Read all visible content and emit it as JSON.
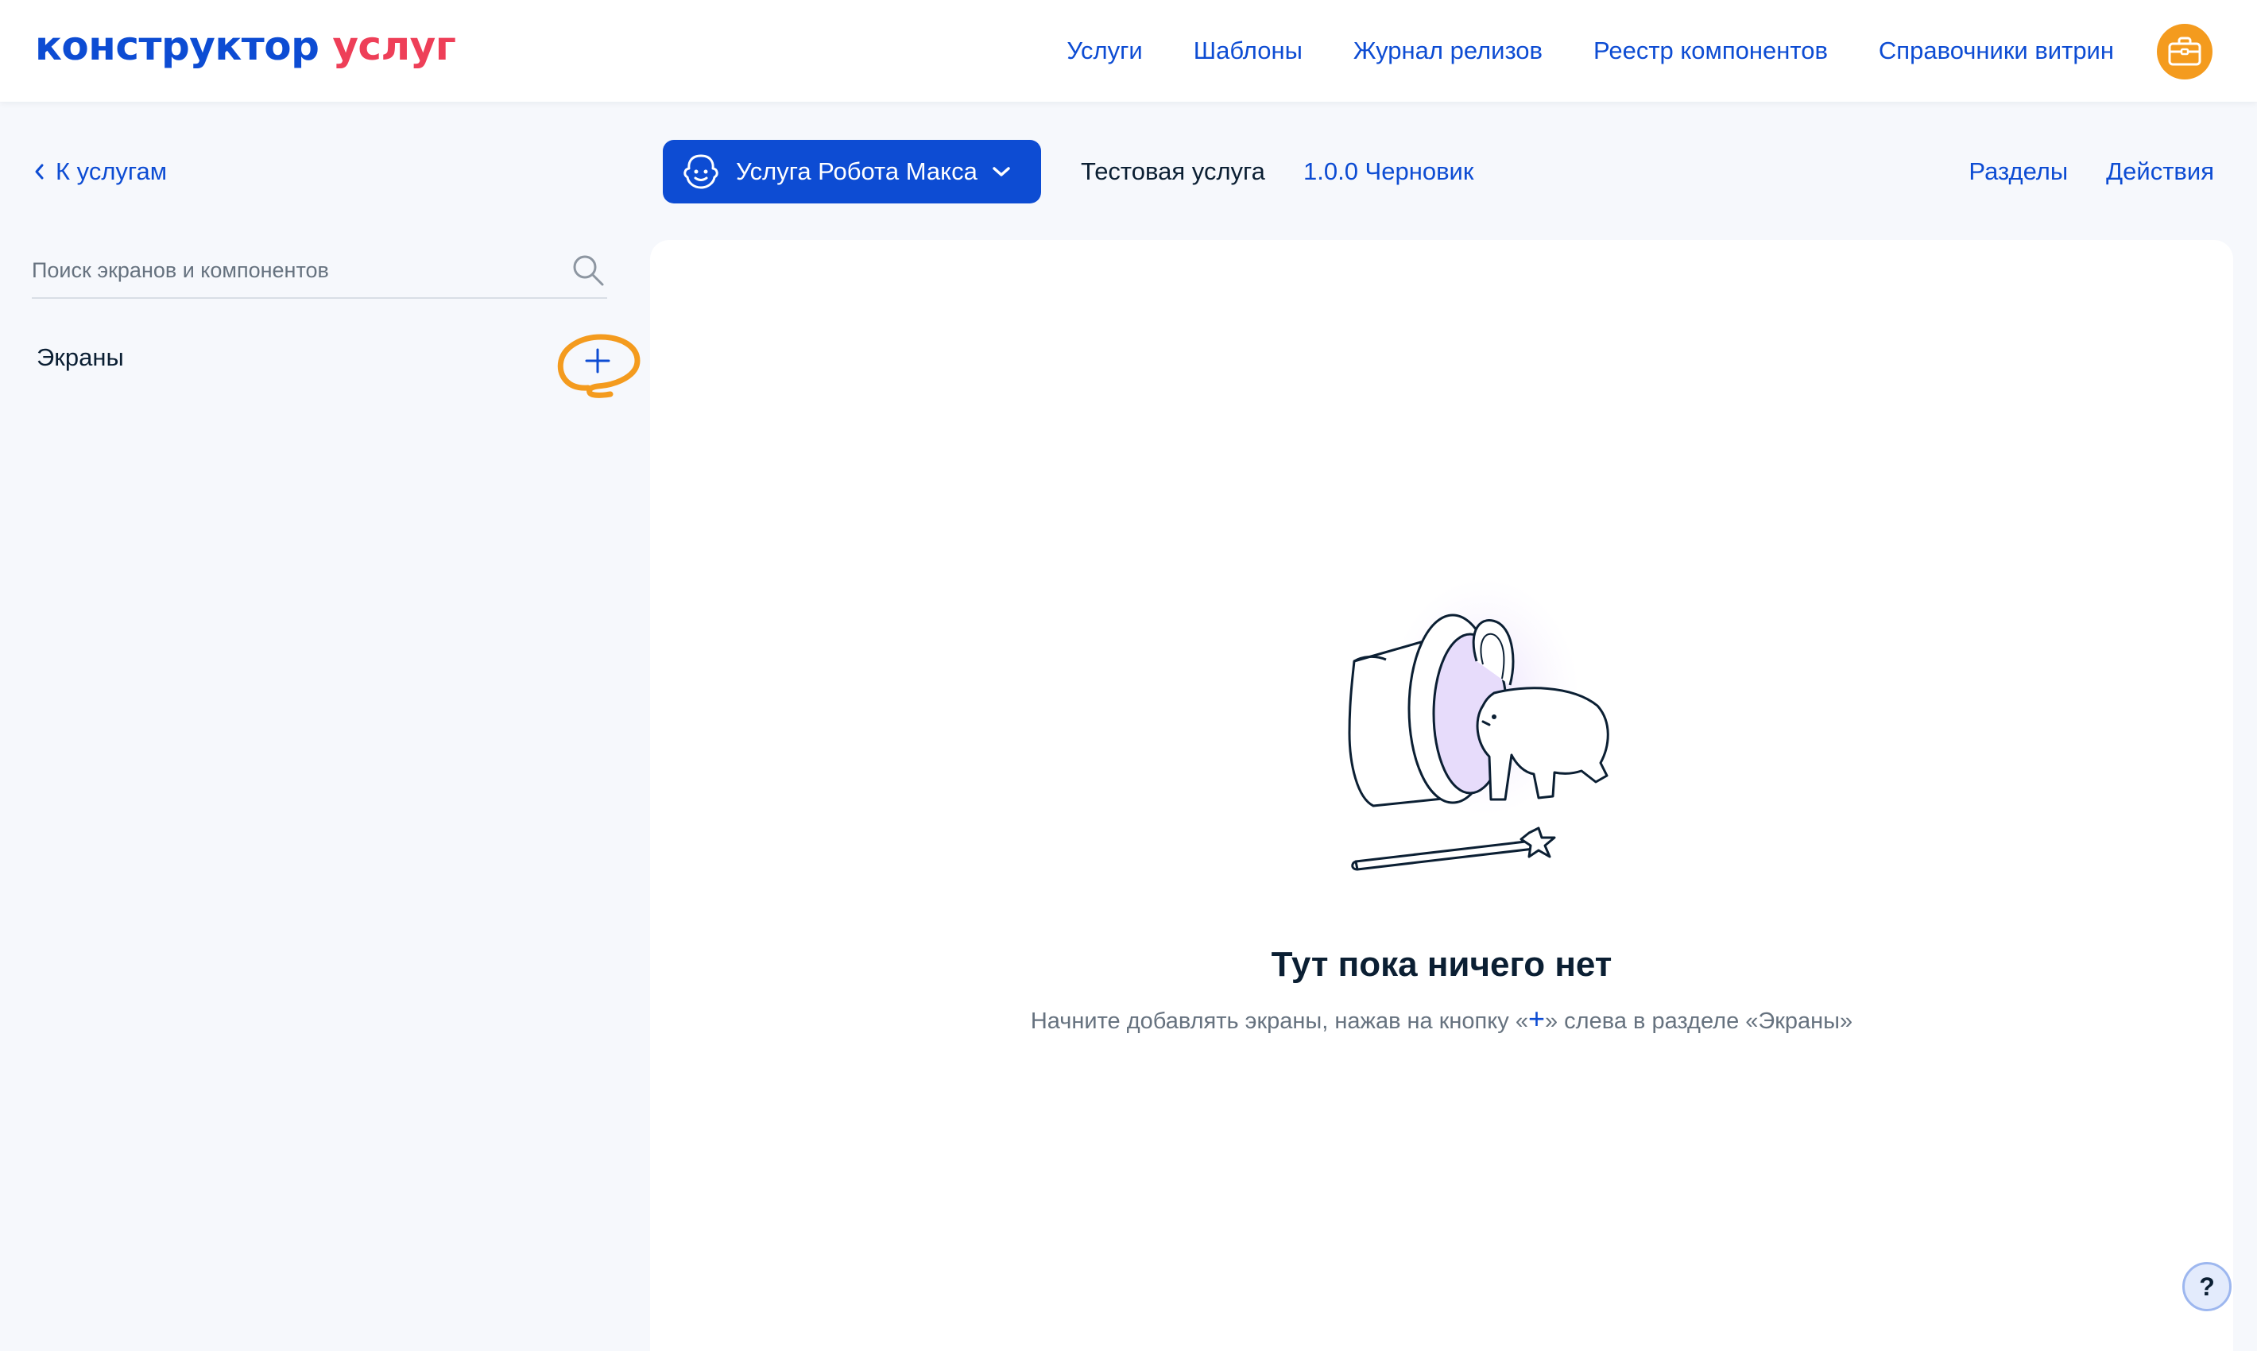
{
  "header": {
    "logo_word1": "конструктор",
    "logo_word2": "услуг",
    "nav": [
      "Услуги",
      "Шаблоны",
      "Журнал релизов",
      "Реестр компонентов",
      "Справочники витрин"
    ],
    "profile_icon": "briefcase-icon"
  },
  "subheader": {
    "back_label": "К услугам",
    "service_button_label": "Услуга Робота Макса",
    "service_name": "Тестовая услуга",
    "version_label": "1.0.0 Черновик",
    "sections_label": "Разделы",
    "actions_label": "Действия"
  },
  "sidebar": {
    "search_placeholder": "Поиск экранов и компонентов",
    "screens_label": "Экраны",
    "add_button_icon": "plus-icon"
  },
  "empty_state": {
    "title": "Тут пока ничего нет",
    "hint_before": "Начните добавлять экраны, нажав на кнопку «",
    "hint_plus": "+",
    "hint_after": "» слева в разделе «Экраны»"
  },
  "help": {
    "label": "?"
  },
  "colors": {
    "brand_blue": "#0d4cd3",
    "brand_red": "#ee3f58",
    "accent_orange": "#f49b1e",
    "page_bg": "#f6f8fc",
    "text_dark": "#0b1f33",
    "text_muted": "#66727f"
  }
}
